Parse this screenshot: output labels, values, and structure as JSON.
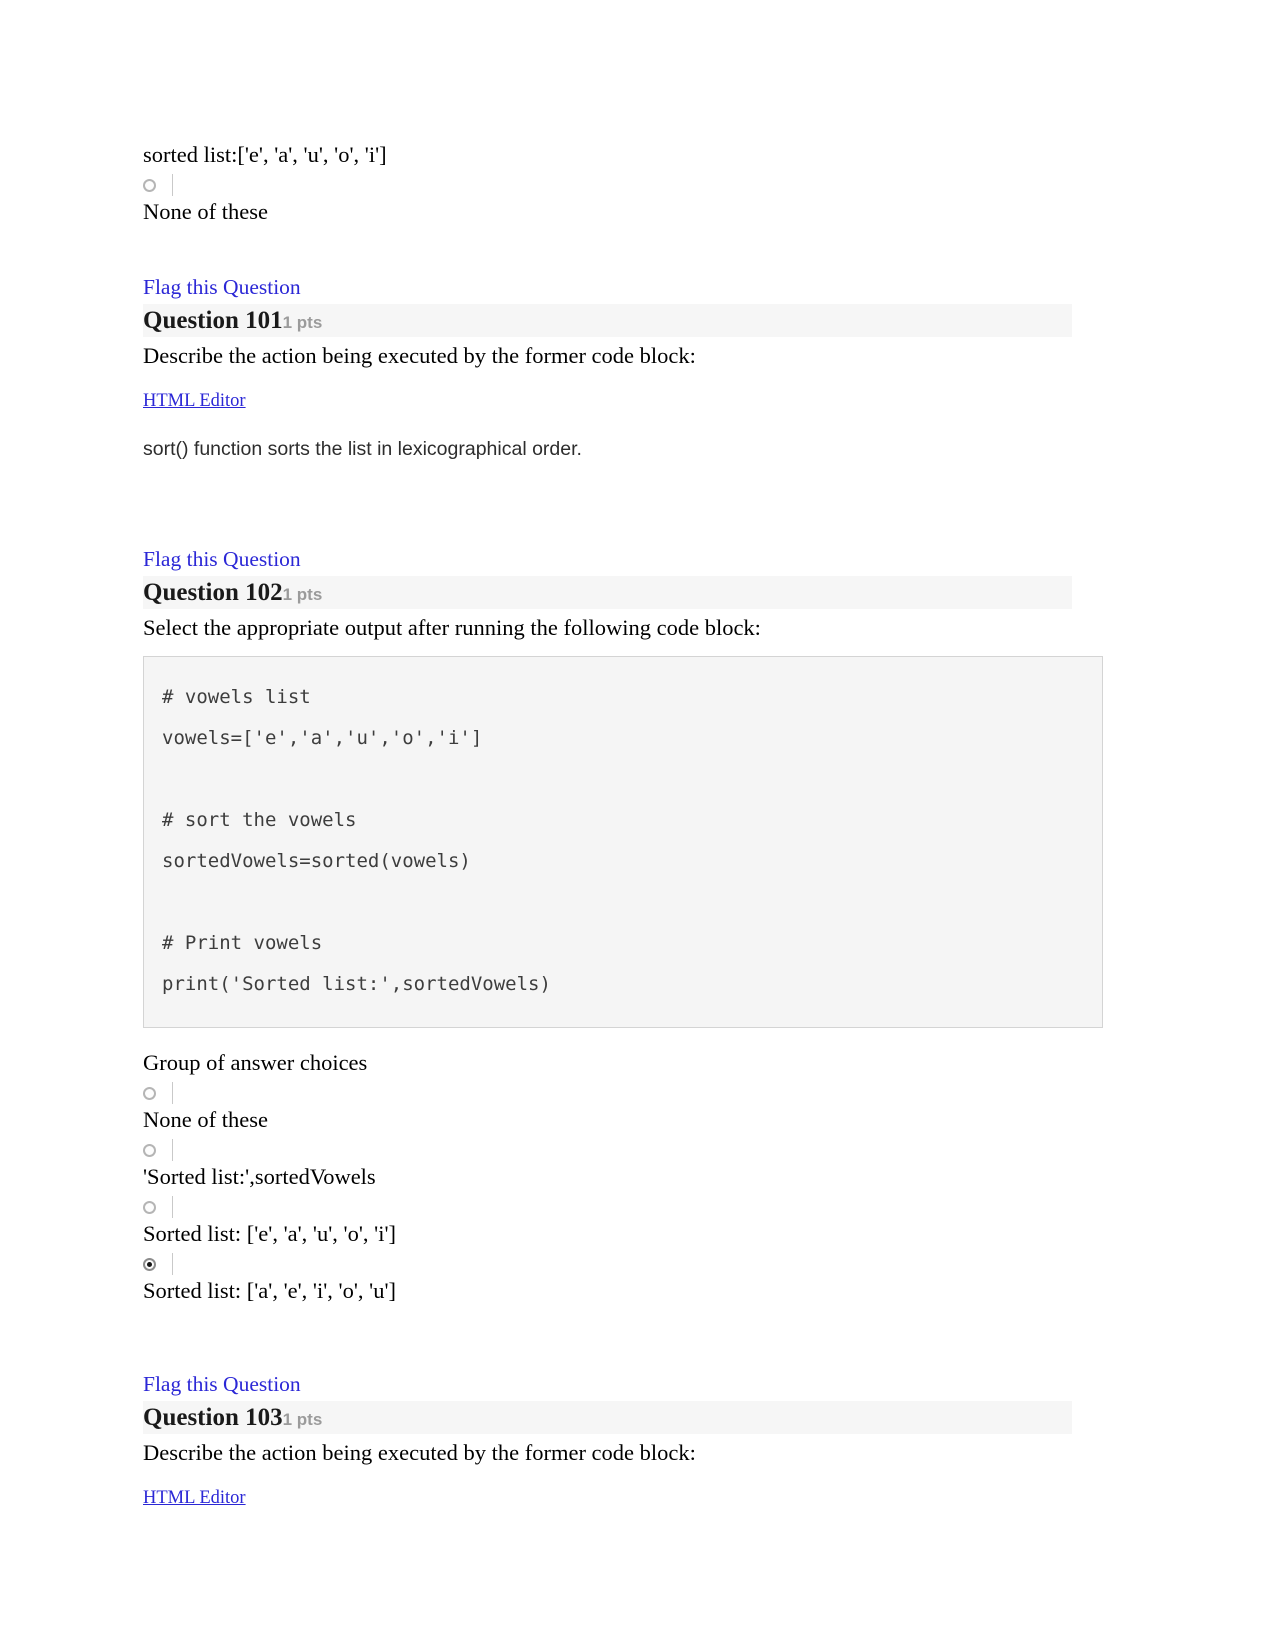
{
  "top_fragment": {
    "previous_choice_text": "sorted list:['e', 'a', 'u', 'o', 'i']",
    "orphan_choice_text": "None of these"
  },
  "flag_label": "Flag this Question",
  "html_editor_label": "HTML Editor",
  "group_label": "Group of answer choices",
  "colors": {
    "link_blue": "#2b27d6",
    "header_band": "#f6f6f6",
    "points_gray": "#9b9b9b",
    "code_bg": "#f5f5f5",
    "code_border": "#d4d4d4"
  },
  "questions": [
    {
      "id": "q101",
      "title": "Question 101",
      "points": "1 pts",
      "prompt": "Describe the action being executed by the former code block:",
      "has_html_editor": true,
      "essay_answer": "sort() function sorts the list in lexicographical order."
    },
    {
      "id": "q102",
      "title": "Question 102",
      "points": "1 pts",
      "prompt": "Select the appropriate output after running the following code block:",
      "code_lines": [
        "# vowels list",
        "vowels=['e','a','u','o','i']",
        "",
        "# sort the vowels",
        "sortedVowels=sorted(vowels)",
        "",
        "# Print vowels",
        "print('Sorted list:',sortedVowels)"
      ],
      "choices": [
        {
          "text": "None of these",
          "selected": false
        },
        {
          "text": "'Sorted list:',sortedVowels",
          "selected": false
        },
        {
          "text": "Sorted list: ['e', 'a', 'u', 'o', 'i']",
          "selected": false
        },
        {
          "text": "Sorted list: ['a', 'e', 'i', 'o', 'u']",
          "selected": true
        }
      ]
    },
    {
      "id": "q103",
      "title": "Question 103",
      "points": "1 pts",
      "prompt": "Describe the action being executed by the former code block:",
      "has_html_editor": true
    }
  ]
}
